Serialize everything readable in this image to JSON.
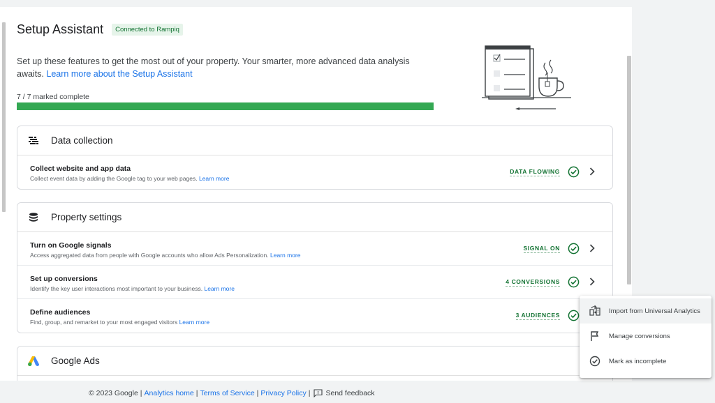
{
  "header": {
    "title": "Setup Assistant",
    "badge": "Connected to Rampiq",
    "description": "Set up these features to get the most out of your property. Your smarter, more advanced data analysis awaits.",
    "learn_more_link": "Learn more about the Setup Assistant"
  },
  "progress": {
    "label": "7 / 7 marked complete",
    "fraction": 1.0,
    "color": "#34a853"
  },
  "sections": {
    "data_collection": {
      "title": "Data collection",
      "icon": "tag-manager-icon",
      "rows": [
        {
          "title": "Collect website and app data",
          "subtitle": "Collect event data by adding the Google tag to your web pages.",
          "learn": "Learn more",
          "status": "DATA FLOWING"
        }
      ]
    },
    "property_settings": {
      "title": "Property settings",
      "icon": "database-icon",
      "rows": [
        {
          "title": "Turn on Google signals",
          "subtitle": "Access aggregated data from people with Google accounts who allow Ads Personalization.",
          "learn": "Learn more",
          "status": "SIGNAL ON"
        },
        {
          "title": "Set up conversions",
          "subtitle": "Identify the key user interactions most important to your business.",
          "learn": "Learn more",
          "status": "4 CONVERSIONS"
        },
        {
          "title": "Define audiences",
          "subtitle": "Find, group, and remarket to your most engaged visitors",
          "learn": "Learn more",
          "status": "3 AUDIENCES"
        }
      ]
    },
    "google_ads": {
      "title": "Google Ads",
      "icon": "google-ads-icon"
    }
  },
  "context_menu": {
    "items": [
      {
        "label": "Import from Universal Analytics",
        "icon": "import-icon"
      },
      {
        "label": "Manage conversions",
        "icon": "flag-icon"
      },
      {
        "label": "Mark as incomplete",
        "icon": "check-circle-icon"
      }
    ]
  },
  "footer": {
    "copyright": "© 2023 Google",
    "analytics_home": "Analytics home",
    "terms": "Terms of Service",
    "privacy": "Privacy Policy",
    "feedback": "Send feedback"
  },
  "colors": {
    "status_green": "#137333",
    "link_blue": "#1a73e8"
  }
}
